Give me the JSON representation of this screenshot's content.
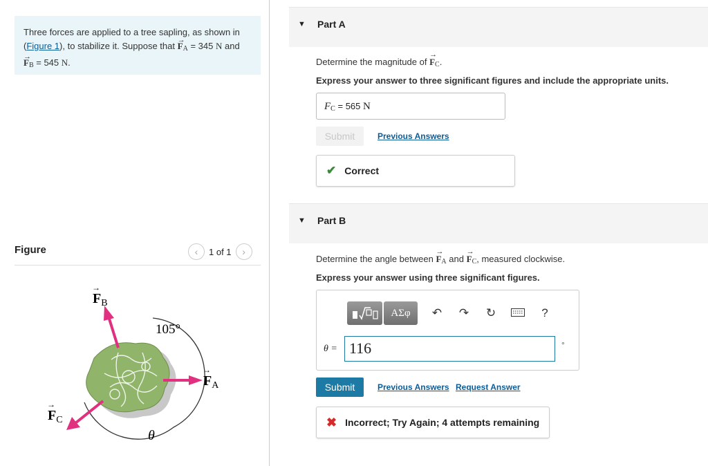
{
  "problem": {
    "text_1": "Three forces are applied to a tree sapling, as shown in",
    "figure_link": "Figure 1",
    "text_2": ", to stabilize it. Suppose that",
    "fa_symbol": "F",
    "fa_sub": "A",
    "fa_value": "= 345",
    "unit_n": "N",
    "and": "and",
    "fb_symbol": "F",
    "fb_sub": "B",
    "fb_value": "= 545",
    "unit_n2": "N",
    "period": "."
  },
  "figure": {
    "title": "Figure",
    "pagination": "1 of 1",
    "prev_icon": "chevron-left-icon",
    "next_icon": "chevron-right-icon",
    "label_fb": "F",
    "label_fb_sub": "B",
    "label_fa": "F",
    "label_fa_sub": "A",
    "label_fc": "F",
    "label_fc_sub": "C",
    "angle_label": "105°",
    "theta_label": "θ",
    "arrow_color": "#e0307f",
    "bush_color": "#8fb46a"
  },
  "part_a": {
    "header": "Part A",
    "question_prefix": "Determine the magnitude of",
    "question_symbol": "F",
    "question_sub": "C",
    "question_suffix": ".",
    "instruction": "Express your answer to three significant figures and include the appropriate units.",
    "answer_symbol": "F",
    "answer_sub": "C",
    "answer_eq": "=",
    "answer_value": "565",
    "answer_unit": "N",
    "submit_label": "Submit",
    "previous_answers": "Previous Answers",
    "feedback": "Correct"
  },
  "part_b": {
    "header": "Part B",
    "q_prefix": "Determine the angle between",
    "q_fa": "F",
    "q_fa_sub": "A",
    "q_and": "and",
    "q_fc": "F",
    "q_fc_sub": "C",
    "q_suffix": ", measured clockwise.",
    "instruction": "Express your answer using three significant figures.",
    "greek_label": "ΑΣφ",
    "help_label": "?",
    "input_label": "θ =",
    "input_value": "116",
    "unit": "°",
    "submit_label": "Submit",
    "previous_answers": "Previous Answers",
    "request_answer": "Request Answer",
    "feedback": "Incorrect; Try Again; 4 attempts remaining"
  }
}
